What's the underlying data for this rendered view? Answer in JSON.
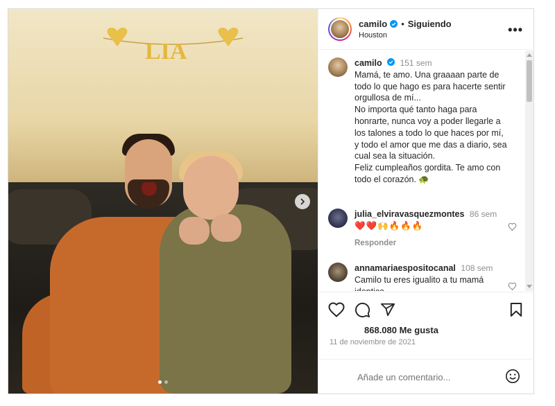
{
  "post": {
    "slide_count": 2,
    "active_slide": 1,
    "image_text": {
      "garland_word": "LIA"
    }
  },
  "header": {
    "username": "camilo",
    "verified": true,
    "separator": "•",
    "follow_status": "Siguiendo",
    "location": "Houston",
    "more_icon": "more-horizontal-icon"
  },
  "caption": {
    "username": "camilo",
    "time": "151 sem",
    "lines": [
      "Mamá, te amo. Una graaaan parte de",
      "todo lo que hago es para hacerte sentir",
      "orgullosa de mí...",
      "No importa qué tanto haga para",
      "honrarte, nunca voy a poder llegarle a",
      "los talones a todo lo que haces por mí,",
      "y todo el amor que me das a diario, sea",
      "cual sea la situación.",
      "Feliz cumpleaños gordita. Te amo con",
      "todo el corazón. 🐢"
    ]
  },
  "comments": [
    {
      "username": "julia_elviravasquezmontes",
      "time": "86 sem",
      "text": "❤️❤️🙌🔥🔥🔥",
      "reply_label": "Responder"
    },
    {
      "username": "annamariaespositocanal",
      "time": "108 sem",
      "text_lines": [
        "Camilo tu eres igualito a tu mamá",
        "identico"
      ]
    }
  ],
  "engagement": {
    "likes": "868.080 Me gusta",
    "date": "11 de noviembre de 2021"
  },
  "add_comment": {
    "placeholder": "Añade un comentario..."
  },
  "colors": {
    "verified": "#0095f6",
    "text": "#262626",
    "muted": "#8e8e8e",
    "border": "#dbdbdb"
  }
}
